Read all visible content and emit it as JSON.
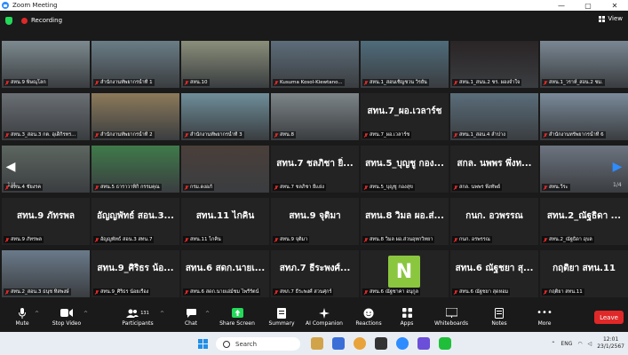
{
  "window": {
    "title": "Zoom Meeting",
    "controls": [
      "—",
      "▢",
      "✕"
    ]
  },
  "topbar": {
    "recording_label": "Recording",
    "view_label": "View"
  },
  "gallery": {
    "page_indicator_left": "1/4",
    "page_indicator_right": "1/4",
    "tiles": [
      {
        "name": "สหน.9 พิษณุโลก",
        "kind": "video",
        "color": "#7c8a8f"
      },
      {
        "name": "สำนักงานทัพยากรน้ำที่ 1",
        "kind": "video",
        "color": "#6a7d86",
        "active": true
      },
      {
        "name": "สหน.10",
        "kind": "video",
        "color": "#8a8f7a"
      },
      {
        "name": "Kusuma Kosol-Kiewtano...",
        "kind": "video",
        "color": "#5d6d7a"
      },
      {
        "name": "สหน.1_สอนเชิญชวน วิรยัน",
        "kind": "video",
        "color": "#4f6c7b"
      },
      {
        "name": "สหน.1_สนน.2 ชร. ผองจำใจ",
        "kind": "video",
        "color": "#2a2426"
      },
      {
        "name": "สหน.1_วราห์_สอน.2 ชม.",
        "kind": "video",
        "color": "#7a8793"
      },
      {
        "name": "สหน.3_สอน.3 กต. อุเด็กิรทร...",
        "kind": "video",
        "color": "#6a6f75"
      },
      {
        "name": "สำนักงานทัพยากรน้ำที่ 2",
        "kind": "video",
        "color": "#8d7a5a"
      },
      {
        "name": "สำนักงานทัพยากรน้ำที่ 3",
        "kind": "video",
        "color": "#6f8e9a"
      },
      {
        "name": "สทน.8",
        "kind": "video",
        "color": "#7d8588"
      },
      {
        "name": "สทน.7_ผอ.เวลาร์ช",
        "kind": "text",
        "big": "สทน.7_ผอ.เวลาร์ช"
      },
      {
        "name": "สทน.1_สอน.4 ลำปาง",
        "kind": "video",
        "color": "#5a6d7a"
      },
      {
        "name": "สำนักงานทรัพยากรน้ำที่ 6",
        "kind": "video",
        "color": "#7a8a9a"
      },
      {
        "name": "สทน.4 ชัยงรค",
        "kind": "video",
        "color": "#5d6660"
      },
      {
        "name": "สทน.5 ธาราวาทิกิ กรรมคุณ",
        "kind": "video",
        "color": "#3f7a4a"
      },
      {
        "name": "กรม.ดงอภั",
        "kind": "video",
        "color": "#4a3f3a"
      },
      {
        "name": "สทน.7 ชลภิชา ยี่เเย่ง",
        "kind": "text",
        "big": "สทน.7 ชลภิชา ยิ่..."
      },
      {
        "name": "สทน.5_บุญชู กองสุข",
        "kind": "text",
        "big": "สทน.5_บุญชู กอง..."
      },
      {
        "name": "สกล. นพพร พึ่งทัพย์",
        "kind": "text",
        "big": "สกล. นพพร พึ่งท..."
      },
      {
        "name": "สทน.วีระ",
        "kind": "video",
        "color": "#6d7480"
      },
      {
        "name": "สทน.9 ภัทรพล",
        "kind": "text",
        "big": "สทน.9 ภัทรพล"
      },
      {
        "name": "อัญญพัทธ์ สอน.3 สทน.7",
        "kind": "text",
        "big": "อัญญพัทธ์ สอน.3..."
      },
      {
        "name": "สทน.11 ไกคิน",
        "kind": "text",
        "big": "สทน.11 ไกคิน"
      },
      {
        "name": "สทน.9 จุติมา",
        "kind": "text",
        "big": "สทน.9 จุติมา"
      },
      {
        "name": "สทน.8 วิมล ผอ.ส่วนอุทกวิทยา",
        "kind": "text",
        "big": "สทน.8 วิมล ผอ.ส่..."
      },
      {
        "name": "กนก. อรพรรณ",
        "kind": "text",
        "big": "กนก. อวพรรณ"
      },
      {
        "name": "สทน.2_ณัฐธิดา อุบล",
        "kind": "text",
        "big": "สทน.2_ณัฐธิดา ..."
      },
      {
        "name": "สทน.2_สอน.3 ธนุช ทิสพงษ์",
        "kind": "video",
        "color": "#6a7a8a"
      },
      {
        "name": "สทน.9_ศิริธร น้อยเรือง",
        "kind": "text",
        "big": "สทน.9_ศิริธร น้อ..."
      },
      {
        "name": "สทน.6 สดก.นายเอ่ม์ชม ไพรีรัตน์",
        "kind": "text",
        "big": "สทน.6 สดก.นายเ..."
      },
      {
        "name": "สทภ.7 ธีระพงศ์ สวนศุกร์",
        "kind": "text",
        "big": "สทภ.7 ธีระพงศ์..."
      },
      {
        "name": "สทน.6 ณัฐชาคา อนุกูล",
        "kind": "avatar",
        "letter": "N",
        "color": "#8bc63f"
      },
      {
        "name": "สทน.6 ณัฐชยา สุดหอม",
        "kind": "text",
        "big": "สทน.6 ณัฐชยา สุ..."
      },
      {
        "name": "กฤติยา สทน.11",
        "kind": "text",
        "big": "กฤติยา สทน.11"
      }
    ]
  },
  "toolbar": {
    "mute": "Mute",
    "stop_video": "Stop Video",
    "participants": "Participants",
    "participants_count": "131",
    "chat": "Chat",
    "share_screen": "Share Screen",
    "summary": "Summary",
    "ai_companion": "AI Companion",
    "reactions": "Reactions",
    "apps": "Apps",
    "whiteboards": "Whiteboards",
    "notes": "Notes",
    "more": "More",
    "leave": "Leave"
  },
  "taskbar": {
    "search_placeholder": "Search",
    "language": "ENG",
    "time": "12:01",
    "date": "23/1/2567"
  }
}
